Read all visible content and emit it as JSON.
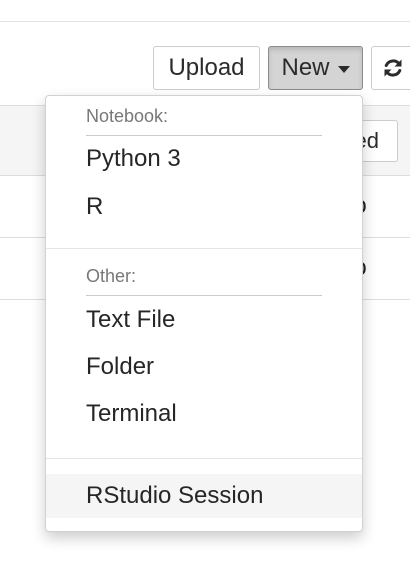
{
  "toolbar": {
    "upload_label": "Upload",
    "new_label": "New",
    "refresh_icon": "refresh-icon"
  },
  "file_list": {
    "header_button_partial": "ed",
    "rows": [
      {
        "modified_partial": "go"
      },
      {
        "modified_partial": "go"
      }
    ]
  },
  "new_menu": {
    "notebook_header": "Notebook:",
    "notebook_items": [
      "Python 3",
      "R"
    ],
    "other_header": "Other:",
    "other_items": [
      "Text File",
      "Folder",
      "Terminal"
    ],
    "extra_items": [
      "RStudio Session"
    ],
    "highlighted_item": "RStudio Session"
  },
  "colors": {
    "active_button_bg": "#d4d4d4",
    "menu_hover_bg": "#f5f5f5",
    "header_text": "#777777"
  }
}
